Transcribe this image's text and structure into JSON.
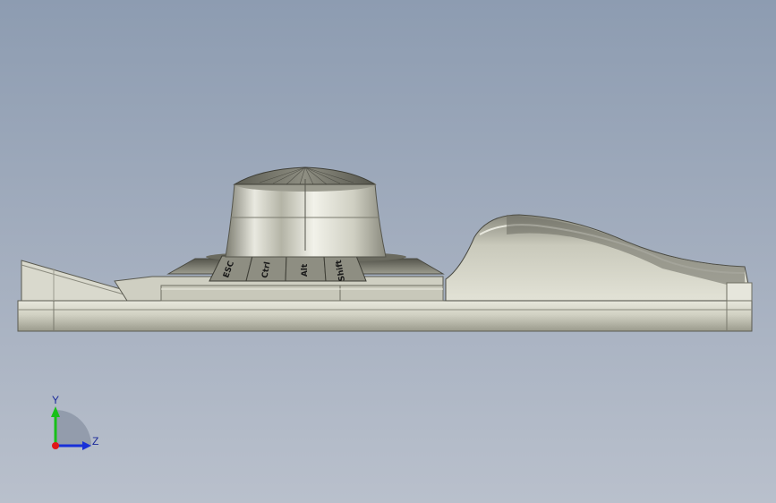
{
  "viewport": {
    "background_top": "#8d9cb1",
    "background_bottom": "#b9c0cc"
  },
  "model": {
    "name": "3D input device (side view)",
    "keys": [
      "ESC",
      "Ctrl",
      "Alt",
      "Shift"
    ],
    "body_color": "#d6d6c8",
    "shadow_color": "#6e6e62"
  },
  "triad": {
    "y_label": "Y",
    "z_label": "Z",
    "y_color": "#18c018",
    "z_color": "#1830d8",
    "x_color": "#e01818"
  }
}
